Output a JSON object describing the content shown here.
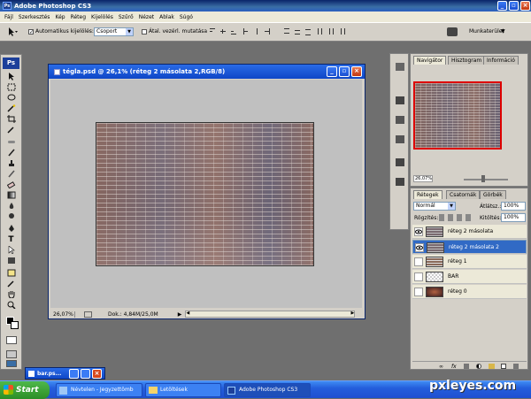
{
  "app": {
    "title": "Adobe Photoshop CS3",
    "ps_badge": "Ps"
  },
  "menu": [
    "Fájl",
    "Szerkesztés",
    "Kép",
    "Réteg",
    "Kijelölés",
    "Szűrő",
    "Nézet",
    "Ablak",
    "Súgó"
  ],
  "options": {
    "auto_select_label": "Automatikus kijelölés:",
    "auto_select_value": "Csoport",
    "transform_label": "Átal. vezérl. mutatása",
    "workspace_label": "Munkaterület"
  },
  "document": {
    "title": "tégla.psd @ 26,1% (réteg 2 másolata 2,RGB/8)",
    "zoom": "26,07%",
    "doc_info": "Dok.: 4,84M/25,0M"
  },
  "right_panel": {
    "nav_tabs": [
      "Navigátor",
      "Hisztogram",
      "Információ"
    ],
    "nav_zoom": "26,07%",
    "layers_tabs": [
      "Rétegek",
      "Csatornák",
      "Görbék"
    ],
    "blend_mode": "Normál",
    "opacity_label": "Átlátsz.:",
    "opacity_value": "100%",
    "lock_label": "Rögzítés:",
    "fill_label": "Kitöltés:",
    "fill_value": "100%",
    "layers": [
      {
        "name": "réteg 2 másolata",
        "visible": true,
        "selected": false
      },
      {
        "name": "réteg 2 másolata 2",
        "visible": true,
        "selected": true
      },
      {
        "name": "réteg 1",
        "visible": false,
        "selected": false
      },
      {
        "name": "BAR",
        "visible": false,
        "selected": false
      },
      {
        "name": "réteg 0",
        "visible": false,
        "selected": false
      }
    ]
  },
  "minimized_doc": {
    "title": "bar.ps..."
  },
  "taskbar": {
    "start": "Start",
    "tasks": [
      "Névtelen - Jegyzettömb",
      "Letöltések",
      "Adobe Photoshop CS3"
    ]
  },
  "watermark": "pxleyes.com",
  "colors": {
    "xp_blue": "#245edc",
    "selected_layer": "#316ac5",
    "start_green": "#2c8e27"
  }
}
